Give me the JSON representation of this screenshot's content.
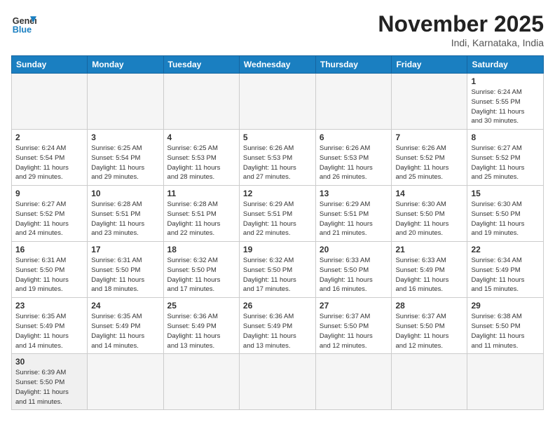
{
  "logo": {
    "line1": "General",
    "line2": "Blue"
  },
  "title": "November 2025",
  "location": "Indi, Karnataka, India",
  "days_of_week": [
    "Sunday",
    "Monday",
    "Tuesday",
    "Wednesday",
    "Thursday",
    "Friday",
    "Saturday"
  ],
  "weeks": [
    [
      {
        "day": "",
        "info": ""
      },
      {
        "day": "",
        "info": ""
      },
      {
        "day": "",
        "info": ""
      },
      {
        "day": "",
        "info": ""
      },
      {
        "day": "",
        "info": ""
      },
      {
        "day": "",
        "info": ""
      },
      {
        "day": "1",
        "info": "Sunrise: 6:24 AM\nSunset: 5:55 PM\nDaylight: 11 hours\nand 30 minutes."
      }
    ],
    [
      {
        "day": "2",
        "info": "Sunrise: 6:24 AM\nSunset: 5:54 PM\nDaylight: 11 hours\nand 29 minutes."
      },
      {
        "day": "3",
        "info": "Sunrise: 6:25 AM\nSunset: 5:54 PM\nDaylight: 11 hours\nand 29 minutes."
      },
      {
        "day": "4",
        "info": "Sunrise: 6:25 AM\nSunset: 5:53 PM\nDaylight: 11 hours\nand 28 minutes."
      },
      {
        "day": "5",
        "info": "Sunrise: 6:26 AM\nSunset: 5:53 PM\nDaylight: 11 hours\nand 27 minutes."
      },
      {
        "day": "6",
        "info": "Sunrise: 6:26 AM\nSunset: 5:53 PM\nDaylight: 11 hours\nand 26 minutes."
      },
      {
        "day": "7",
        "info": "Sunrise: 6:26 AM\nSunset: 5:52 PM\nDaylight: 11 hours\nand 25 minutes."
      },
      {
        "day": "8",
        "info": "Sunrise: 6:27 AM\nSunset: 5:52 PM\nDaylight: 11 hours\nand 25 minutes."
      }
    ],
    [
      {
        "day": "9",
        "info": "Sunrise: 6:27 AM\nSunset: 5:52 PM\nDaylight: 11 hours\nand 24 minutes."
      },
      {
        "day": "10",
        "info": "Sunrise: 6:28 AM\nSunset: 5:51 PM\nDaylight: 11 hours\nand 23 minutes."
      },
      {
        "day": "11",
        "info": "Sunrise: 6:28 AM\nSunset: 5:51 PM\nDaylight: 11 hours\nand 22 minutes."
      },
      {
        "day": "12",
        "info": "Sunrise: 6:29 AM\nSunset: 5:51 PM\nDaylight: 11 hours\nand 22 minutes."
      },
      {
        "day": "13",
        "info": "Sunrise: 6:29 AM\nSunset: 5:51 PM\nDaylight: 11 hours\nand 21 minutes."
      },
      {
        "day": "14",
        "info": "Sunrise: 6:30 AM\nSunset: 5:50 PM\nDaylight: 11 hours\nand 20 minutes."
      },
      {
        "day": "15",
        "info": "Sunrise: 6:30 AM\nSunset: 5:50 PM\nDaylight: 11 hours\nand 19 minutes."
      }
    ],
    [
      {
        "day": "16",
        "info": "Sunrise: 6:31 AM\nSunset: 5:50 PM\nDaylight: 11 hours\nand 19 minutes."
      },
      {
        "day": "17",
        "info": "Sunrise: 6:31 AM\nSunset: 5:50 PM\nDaylight: 11 hours\nand 18 minutes."
      },
      {
        "day": "18",
        "info": "Sunrise: 6:32 AM\nSunset: 5:50 PM\nDaylight: 11 hours\nand 17 minutes."
      },
      {
        "day": "19",
        "info": "Sunrise: 6:32 AM\nSunset: 5:50 PM\nDaylight: 11 hours\nand 17 minutes."
      },
      {
        "day": "20",
        "info": "Sunrise: 6:33 AM\nSunset: 5:50 PM\nDaylight: 11 hours\nand 16 minutes."
      },
      {
        "day": "21",
        "info": "Sunrise: 6:33 AM\nSunset: 5:49 PM\nDaylight: 11 hours\nand 16 minutes."
      },
      {
        "day": "22",
        "info": "Sunrise: 6:34 AM\nSunset: 5:49 PM\nDaylight: 11 hours\nand 15 minutes."
      }
    ],
    [
      {
        "day": "23",
        "info": "Sunrise: 6:35 AM\nSunset: 5:49 PM\nDaylight: 11 hours\nand 14 minutes."
      },
      {
        "day": "24",
        "info": "Sunrise: 6:35 AM\nSunset: 5:49 PM\nDaylight: 11 hours\nand 14 minutes."
      },
      {
        "day": "25",
        "info": "Sunrise: 6:36 AM\nSunset: 5:49 PM\nDaylight: 11 hours\nand 13 minutes."
      },
      {
        "day": "26",
        "info": "Sunrise: 6:36 AM\nSunset: 5:49 PM\nDaylight: 11 hours\nand 13 minutes."
      },
      {
        "day": "27",
        "info": "Sunrise: 6:37 AM\nSunset: 5:50 PM\nDaylight: 11 hours\nand 12 minutes."
      },
      {
        "day": "28",
        "info": "Sunrise: 6:37 AM\nSunset: 5:50 PM\nDaylight: 11 hours\nand 12 minutes."
      },
      {
        "day": "29",
        "info": "Sunrise: 6:38 AM\nSunset: 5:50 PM\nDaylight: 11 hours\nand 11 minutes."
      }
    ],
    [
      {
        "day": "30",
        "info": "Sunrise: 6:39 AM\nSunset: 5:50 PM\nDaylight: 11 hours\nand 11 minutes."
      },
      {
        "day": "",
        "info": ""
      },
      {
        "day": "",
        "info": ""
      },
      {
        "day": "",
        "info": ""
      },
      {
        "day": "",
        "info": ""
      },
      {
        "day": "",
        "info": ""
      },
      {
        "day": "",
        "info": ""
      }
    ]
  ]
}
